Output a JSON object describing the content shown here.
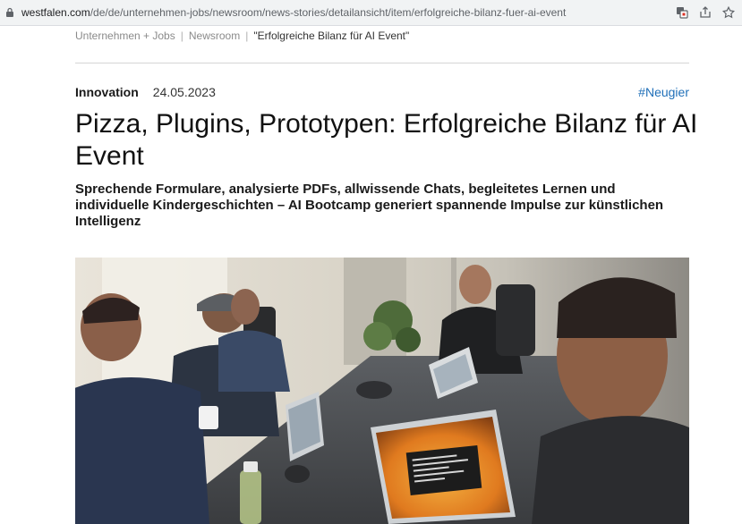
{
  "browser": {
    "url_host": "westfalen.com",
    "url_path": "/de/de/unternehmen-jobs/newsroom/news-stories/detailansicht/item/erfolgreiche-bilanz-fuer-ai-event"
  },
  "breadcrumb": {
    "items": [
      "Unternehmen + Jobs",
      "Newsroom"
    ],
    "current": "\"Erfolgreiche Bilanz für AI Event\"",
    "separator": "|"
  },
  "article": {
    "category": "Innovation",
    "date": "24.05.2023",
    "tag": "#Neugier",
    "title": "Pizza, Plugins, Prototypen: Erfolgreiche Bilanz für AI Event",
    "subtitle": "Sprechende Formulare, analysierte PDFs, allwissende Chats, begleitetes Lernen und individuelle Kindergeschichten – AI Bootcamp generiert spannende Impulse zur künstlichen Intelligenz"
  },
  "colors": {
    "tag_link": "#1f6fb8",
    "breadcrumb_text": "#8a8a8a"
  }
}
